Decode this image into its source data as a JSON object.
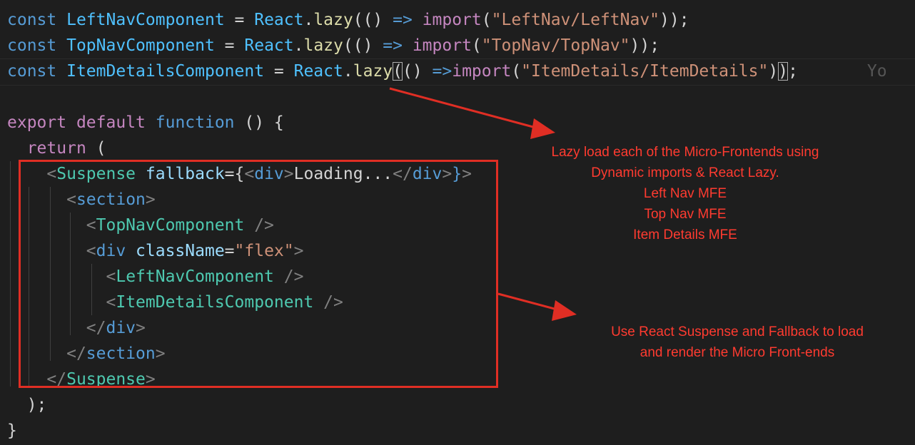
{
  "code": {
    "line1": {
      "kw_const": "const",
      "ident": "LeftNavComponent",
      "eq": " = ",
      "react": "React",
      "dot": ".",
      "lazy": "lazy",
      "open": "(() ",
      "arrow": "=>",
      "import_kw": "import",
      "paren": "(",
      "module": "\"LeftNav/LeftNav\"",
      "close": "));"
    },
    "line2": {
      "kw_const": "const",
      "ident": "TopNavComponent",
      "eq": " = ",
      "react": "React",
      "dot": ".",
      "lazy": "lazy",
      "open": "(() ",
      "arrow": "=>",
      "import_kw": "import",
      "paren": "(",
      "module": "\"TopNav/TopNav\"",
      "close": "));"
    },
    "line3": {
      "kw_const": "const",
      "ident": "ItemDetailsComponent",
      "eq": " = ",
      "react": "React",
      "dot": ".",
      "lazy": "lazy",
      "lparen": "(",
      "open": "() ",
      "arrow": "=>",
      "import_kw": "import",
      "paren": "(",
      "module": "\"ItemDetails/ItemDetails\"",
      "rparen": ")",
      "rparen_box": ")",
      "semi": ";",
      "ghost": "Yo"
    },
    "line5": {
      "kw_export": "export",
      "kw_default": "default",
      "kw_function": "function",
      "rest": " () {"
    },
    "line6": {
      "kw_return": "return",
      "rest": " ("
    },
    "line7": {
      "lt": "<",
      "tag": "Suspense",
      "attr": "fallback",
      "eq": "={",
      "inner_lt": "<",
      "inner_tag": "div",
      "inner_gt": ">",
      "text": "Loading...",
      "inner_close_lt": "</",
      "inner_close_tag": "div",
      "inner_close_gt": ">",
      "brace": "}",
      "gt": ">"
    },
    "line8": {
      "lt": "<",
      "tag": "section",
      "gt": ">"
    },
    "line9": {
      "lt": "<",
      "tag": "TopNavComponent",
      "gt": " />"
    },
    "line10": {
      "lt": "<",
      "tag": "div",
      "attr": "className",
      "eq": "=",
      "value": "\"flex\"",
      "gt": ">"
    },
    "line11": {
      "lt": "<",
      "tag": "LeftNavComponent",
      "gt": " />"
    },
    "line12": {
      "lt": "<",
      "tag": "ItemDetailsComponent",
      "gt": " />"
    },
    "line13": {
      "lt": "</",
      "tag": "div",
      "gt": ">"
    },
    "line14": {
      "lt": "</",
      "tag": "section",
      "gt": ">"
    },
    "line15": {
      "lt": "</",
      "tag": "Suspense",
      "gt": ">"
    },
    "line16": {
      "text": ");"
    },
    "line17": {
      "text": "}"
    }
  },
  "annotations": {
    "lazy_note": [
      "Lazy load each of the Micro-Frontends using",
      "Dynamic imports & React Lazy.",
      "Left Nav MFE",
      "Top Nav MFE",
      "Item Details MFE"
    ],
    "suspense_note": [
      "Use React Suspense and Fallback to load",
      "and render the Micro Front-ends"
    ]
  },
  "colors": {
    "background": "#1e1e1e",
    "annotation": "#ff3b30",
    "box": "#e02e24",
    "keyword": "#569cd6",
    "string": "#ce9178",
    "tag": "#4ec9b0"
  }
}
